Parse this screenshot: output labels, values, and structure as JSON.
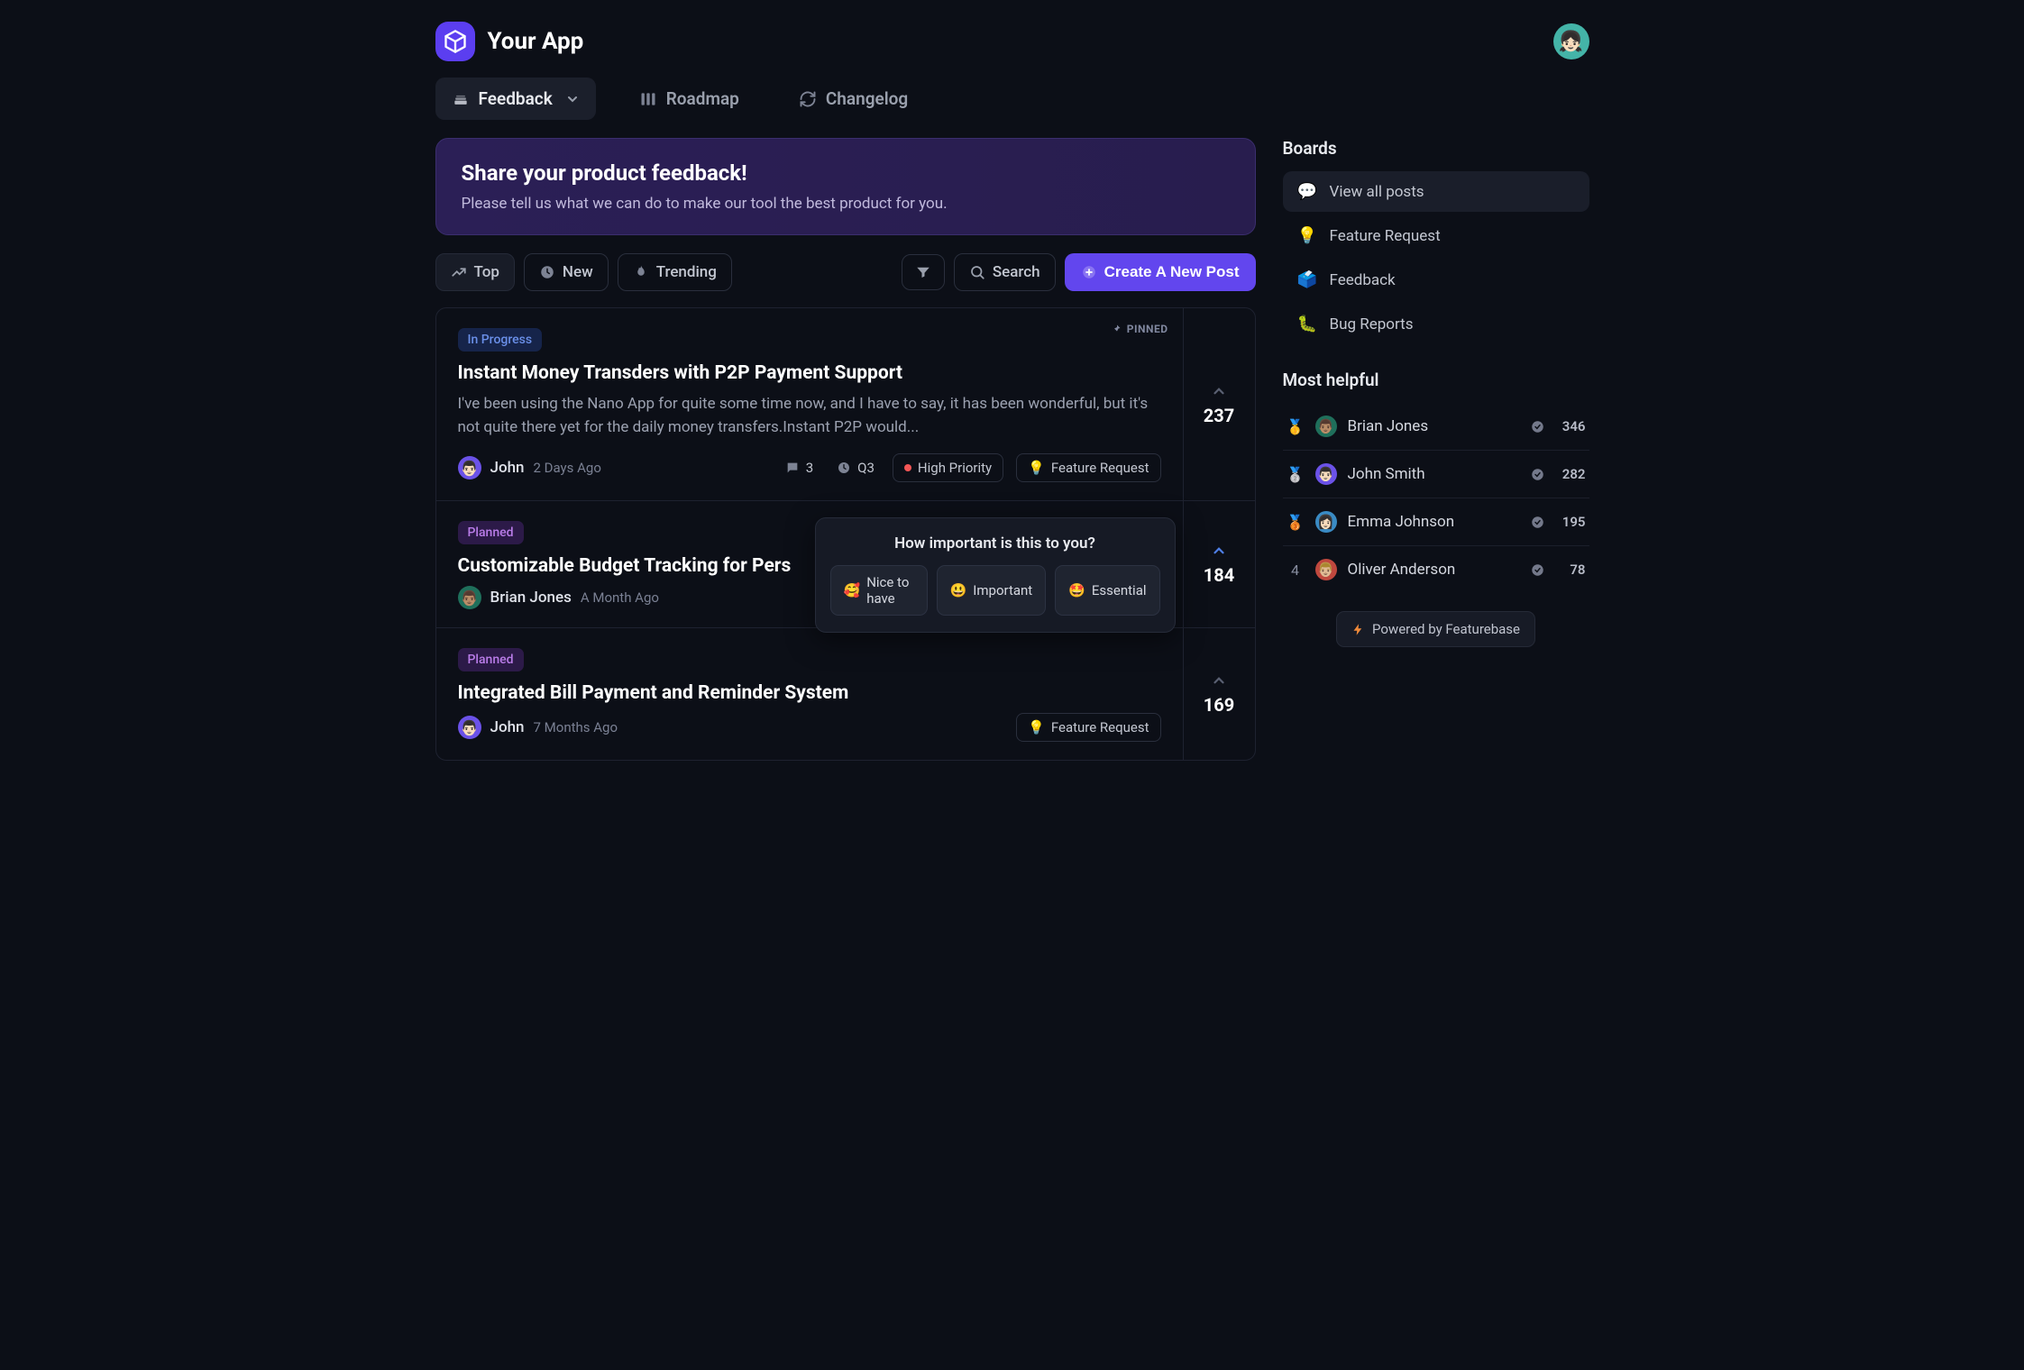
{
  "brand": {
    "title": "Your App"
  },
  "nav": {
    "feedback": "Feedback",
    "roadmap": "Roadmap",
    "changelog": "Changelog"
  },
  "banner": {
    "title": "Share your product feedback!",
    "subtitle": "Please tell us what we can do to make our tool the best product for you."
  },
  "filters": {
    "top": "Top",
    "new": "New",
    "trending": "Trending",
    "search": "Search",
    "create": "Create A New Post"
  },
  "posts": [
    {
      "pinned_label": "PINNED",
      "status": "In Progress",
      "status_class": "progress",
      "title": "Instant Money Transders with P2P Payment Support",
      "excerpt": "I've been using the Nano App for quite some time now, and I have to say, it has been wonderful, but it's not quite there yet for the daily money transfers.Instant P2P would...",
      "author": "John",
      "time": "2 Days Ago",
      "avatar_bg": "#6b52e8",
      "avatar_emoji": "👨🏻",
      "upvotes": "237",
      "upvote_active": false,
      "comments": "3",
      "quarter": "Q3",
      "priority": "High Priority",
      "category": "Feature Request"
    },
    {
      "status": "Planned",
      "status_class": "planned",
      "title": "Customizable Budget Tracking for Pers",
      "author": "Brian Jones",
      "time": "A Month Ago",
      "avatar_bg": "#1f6f5b",
      "avatar_emoji": "👨🏽",
      "upvotes": "184",
      "upvote_active": true
    },
    {
      "status": "Planned",
      "status_class": "planned",
      "title": "Integrated Bill Payment and Reminder System",
      "author": "John",
      "time": "7 Months Ago",
      "avatar_bg": "#6b52e8",
      "avatar_emoji": "👨🏻",
      "upvotes": "169",
      "upvote_active": false,
      "category": "Feature Request"
    }
  ],
  "importance": {
    "title": "How important is this to you?",
    "options": [
      {
        "emoji": "🥰",
        "label": "Nice to have"
      },
      {
        "emoji": "😃",
        "label": "Important"
      },
      {
        "emoji": "🤩",
        "label": "Essential"
      }
    ]
  },
  "sidebar": {
    "boards_heading": "Boards",
    "boards": [
      {
        "icon": "💬",
        "label": "View all posts",
        "active": true
      },
      {
        "icon": "💡",
        "label": "Feature Request"
      },
      {
        "icon": "🗳️",
        "label": "Feedback"
      },
      {
        "icon": "🐛",
        "label": "Bug Reports"
      }
    ],
    "helpful_heading": "Most helpful",
    "helpful": [
      {
        "medal": "🥇",
        "avatar_bg": "#1f6f5b",
        "avatar_emoji": "👨🏽",
        "name": "Brian Jones",
        "count": "346"
      },
      {
        "medal": "🥈",
        "avatar_bg": "#6b52e8",
        "avatar_emoji": "👨🏻",
        "name": "John Smith",
        "count": "282"
      },
      {
        "medal": "🥉",
        "avatar_bg": "#3a8bc4",
        "avatar_emoji": "👩🏻",
        "name": "Emma Johnson",
        "count": "195"
      },
      {
        "medal": "4",
        "avatar_bg": "#c0483e",
        "avatar_emoji": "👨🏼",
        "name": "Oliver Anderson",
        "count": "78"
      }
    ],
    "powered": "Powered by Featurebase"
  }
}
